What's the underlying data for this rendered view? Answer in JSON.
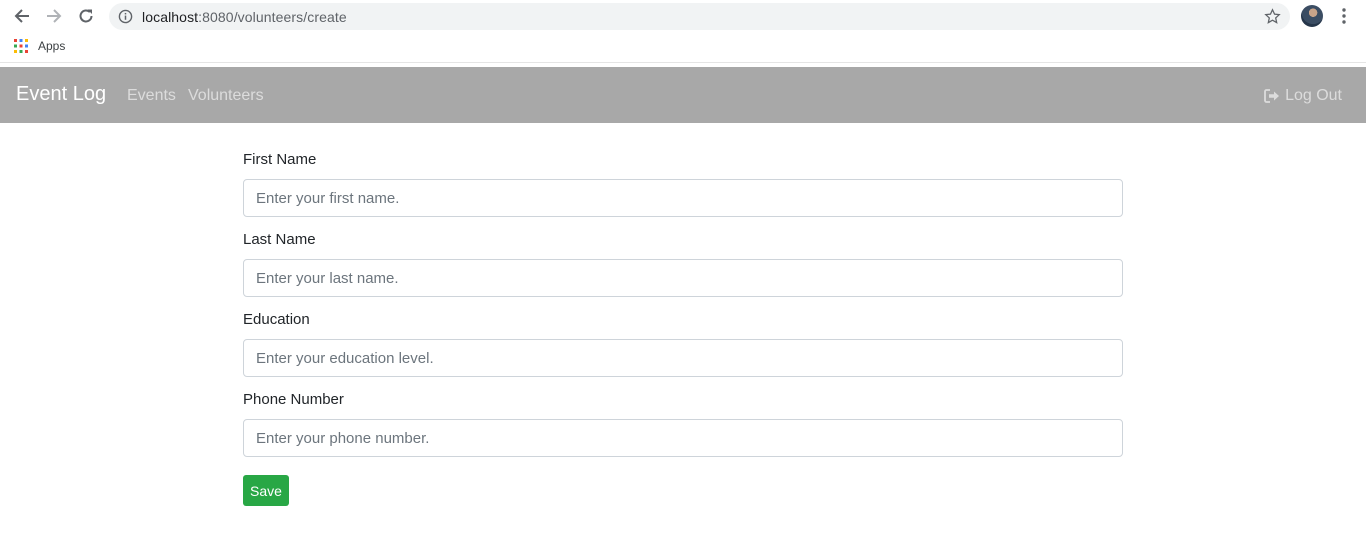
{
  "browser": {
    "url_host": "localhost",
    "url_rest": ":8080/volunteers/create",
    "bookmarks": [
      {
        "label": "Apps",
        "icon": "apps-grid-icon"
      }
    ]
  },
  "navbar": {
    "brand": "Event Log",
    "links": [
      {
        "label": "Events"
      },
      {
        "label": "Volunteers"
      }
    ],
    "logout_label": "Log Out",
    "background": "#a8a8a8"
  },
  "form": {
    "fields": [
      {
        "label": "First Name",
        "placeholder": "Enter your first name.",
        "value": ""
      },
      {
        "label": "Last Name",
        "placeholder": "Enter your last name.",
        "value": ""
      },
      {
        "label": "Education",
        "placeholder": "Enter your education level.",
        "value": ""
      },
      {
        "label": "Phone Number",
        "placeholder": "Enter your phone number.",
        "value": ""
      }
    ],
    "submit_label": "Save",
    "submit_color": "#28a745"
  }
}
